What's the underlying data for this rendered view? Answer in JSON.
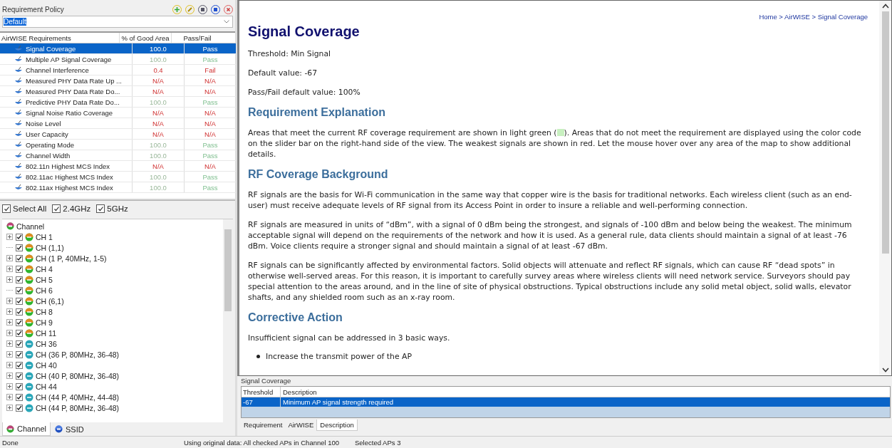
{
  "policy": {
    "title": "Requirement Policy",
    "value": "Default"
  },
  "requirements": {
    "columns": [
      "AirWISE Requirements",
      "% of Good Area",
      "Pass/Fail"
    ],
    "rows": [
      {
        "name": "Signal Coverage",
        "area": "100.0",
        "result": "Pass",
        "kind": "pass",
        "selected": true
      },
      {
        "name": "Multiple AP Signal Coverage",
        "area": "100.0",
        "result": "Pass",
        "kind": "pass",
        "selected": false
      },
      {
        "name": "Channel Interference",
        "area": "0.4",
        "result": "Fail",
        "kind": "fail",
        "selected": false
      },
      {
        "name": "Measured PHY Data Rate Up ...",
        "area": "N/A",
        "result": "N/A",
        "kind": "na",
        "selected": false
      },
      {
        "name": "Measured PHY Data Rate Do...",
        "area": "N/A",
        "result": "N/A",
        "kind": "na",
        "selected": false
      },
      {
        "name": "Predictive PHY Data Rate Do...",
        "area": "100.0",
        "result": "Pass",
        "kind": "pass",
        "selected": false
      },
      {
        "name": "Signal Noise Ratio Coverage",
        "area": "N/A",
        "result": "N/A",
        "kind": "na",
        "selected": false
      },
      {
        "name": "Noise Level",
        "area": "N/A",
        "result": "N/A",
        "kind": "na",
        "selected": false
      },
      {
        "name": "User Capacity",
        "area": "N/A",
        "result": "N/A",
        "kind": "na",
        "selected": false
      },
      {
        "name": "Operating Mode",
        "area": "100.0",
        "result": "Pass",
        "kind": "pass",
        "selected": false
      },
      {
        "name": "Channel Width",
        "area": "100.0",
        "result": "Pass",
        "kind": "pass",
        "selected": false
      },
      {
        "name": "802.11n Highest MCS Index",
        "area": "N/A",
        "result": "N/A",
        "kind": "na",
        "selected": false
      },
      {
        "name": "802.11ac Highest MCS Index",
        "area": "100.0",
        "result": "Pass",
        "kind": "pass",
        "selected": false
      },
      {
        "name": "802.11ax Highest MCS Index",
        "area": "100.0",
        "result": "Pass",
        "kind": "pass",
        "selected": false
      }
    ]
  },
  "filters": [
    {
      "label": "Select All",
      "checked": true
    },
    {
      "label": "2.4GHz",
      "checked": true
    },
    {
      "label": "5GHz",
      "checked": true
    }
  ],
  "tree": {
    "label": "Channel",
    "children": [
      {
        "label": "CH 1",
        "kind": "ghz24",
        "checked": true,
        "expandable": true
      },
      {
        "label": "CH (1,1)",
        "kind": "ghz24",
        "checked": true,
        "expandable": false
      },
      {
        "label": "CH (1 P, 40MHz, 1-5)",
        "kind": "ghz24",
        "checked": true,
        "expandable": true
      },
      {
        "label": "CH 4",
        "kind": "ghz24",
        "checked": true,
        "expandable": true
      },
      {
        "label": "CH 5",
        "kind": "ghz24",
        "checked": true,
        "expandable": true
      },
      {
        "label": "CH 6",
        "kind": "ghz24",
        "checked": true,
        "expandable": false
      },
      {
        "label": "CH (6,1)",
        "kind": "ghz24",
        "checked": true,
        "expandable": true
      },
      {
        "label": "CH 8",
        "kind": "ghz24",
        "checked": true,
        "expandable": true
      },
      {
        "label": "CH 9",
        "kind": "ghz24",
        "checked": true,
        "expandable": true
      },
      {
        "label": "CH 11",
        "kind": "ghz24",
        "checked": true,
        "expandable": true
      },
      {
        "label": "CH 36",
        "kind": "ghz5",
        "checked": true,
        "expandable": true
      },
      {
        "label": "CH (36 P, 80MHz, 36-48)",
        "kind": "ghz5",
        "checked": true,
        "expandable": true
      },
      {
        "label": "CH 40",
        "kind": "ghz5",
        "checked": true,
        "expandable": true
      },
      {
        "label": "CH (40 P, 80MHz, 36-48)",
        "kind": "ghz5",
        "checked": true,
        "expandable": true
      },
      {
        "label": "CH 44",
        "kind": "ghz5",
        "checked": true,
        "expandable": true
      },
      {
        "label": "CH (44 P, 40MHz, 44-48)",
        "kind": "ghz5",
        "checked": true,
        "expandable": true
      },
      {
        "label": "CH (44 P, 80MHz, 36-48)",
        "kind": "ghz5",
        "checked": true,
        "expandable": true
      }
    ]
  },
  "left_tabs": [
    {
      "label": "Channel",
      "selected": true
    },
    {
      "label": "SSID",
      "selected": false
    }
  ],
  "breadcrumb": "Home > AirWISE > Signal Coverage",
  "article": [
    {
      "kind": "h1",
      "text": "Signal Coverage"
    },
    {
      "kind": "p",
      "text": "Threshold: Min Signal"
    },
    {
      "kind": "p",
      "text": "Default value: -67"
    },
    {
      "kind": "p",
      "text": "Pass/Fail default value: 100%"
    },
    {
      "kind": "h2",
      "text": "Requirement Explanation"
    },
    {
      "kind": "swatch_p",
      "before": "Areas that meet the current RF coverage requirement are shown in light green (",
      "after": "). Areas that do not meet the requirement are displayed using the color code on the slider bar on the right-hand side of the view. The weakest signals are shown in red. Let the mouse hover over any area of the map to show additional details.",
      "color": "#c8f0c0"
    },
    {
      "kind": "h2",
      "text": "RF Coverage Background"
    },
    {
      "kind": "p",
      "text": "RF signals are the basis for Wi-Fi communication in the same way that copper wire is the basis for traditional networks. Each wireless client (such as an end-user) must receive adequate levels of RF signal from its Access Point in order to insure a reliable and well-performing connection."
    },
    {
      "kind": "p",
      "text": "RF signals are measured in units of “dBm”, with a signal of 0 dBm being the strongest, and signals of -100 dBm and below being the weakest. The minimum acceptable signal will depend on the requirements of the network and how it is used. As a general rule, data clients should maintain a signal of at least -76 dBm. Voice clients require a stronger signal and should maintain a signal of at least -67 dBm."
    },
    {
      "kind": "p",
      "text": "RF signals can be significantly affected by environmental factors. Solid objects will attenuate and reflect RF signals, which can cause RF “dead spots” in otherwise well-served areas. For this reason, it is important to carefully survey areas where wireless clients will need network service. Surveyors should pay special attention to the areas around, and in the line of site of physical obstructions. Typical obstructions include any solid metal object, solid walls, elevator shafts, and any shielded room such as an x-ray room."
    },
    {
      "kind": "h2",
      "text": "Corrective Action"
    },
    {
      "kind": "p",
      "text": "Insufficient signal can be addressed in 3 basic ways."
    },
    {
      "kind": "li",
      "text": "Increase the transmit power of the AP"
    }
  ],
  "detail": {
    "title": "Signal Coverage",
    "columns": [
      "Threshold",
      "Description"
    ],
    "rows": [
      {
        "threshold": "-67",
        "description": "Minimum AP signal strength required",
        "selected": true
      }
    ]
  },
  "bottom_tabs": [
    {
      "label": "Requirement",
      "selected": false
    },
    {
      "label": "AirWISE",
      "selected": false
    },
    {
      "label": "Description",
      "selected": true
    }
  ],
  "status_bar": [
    "Done",
    "Using original data: All checked APs in Channel 100",
    "Selected APs 3"
  ]
}
